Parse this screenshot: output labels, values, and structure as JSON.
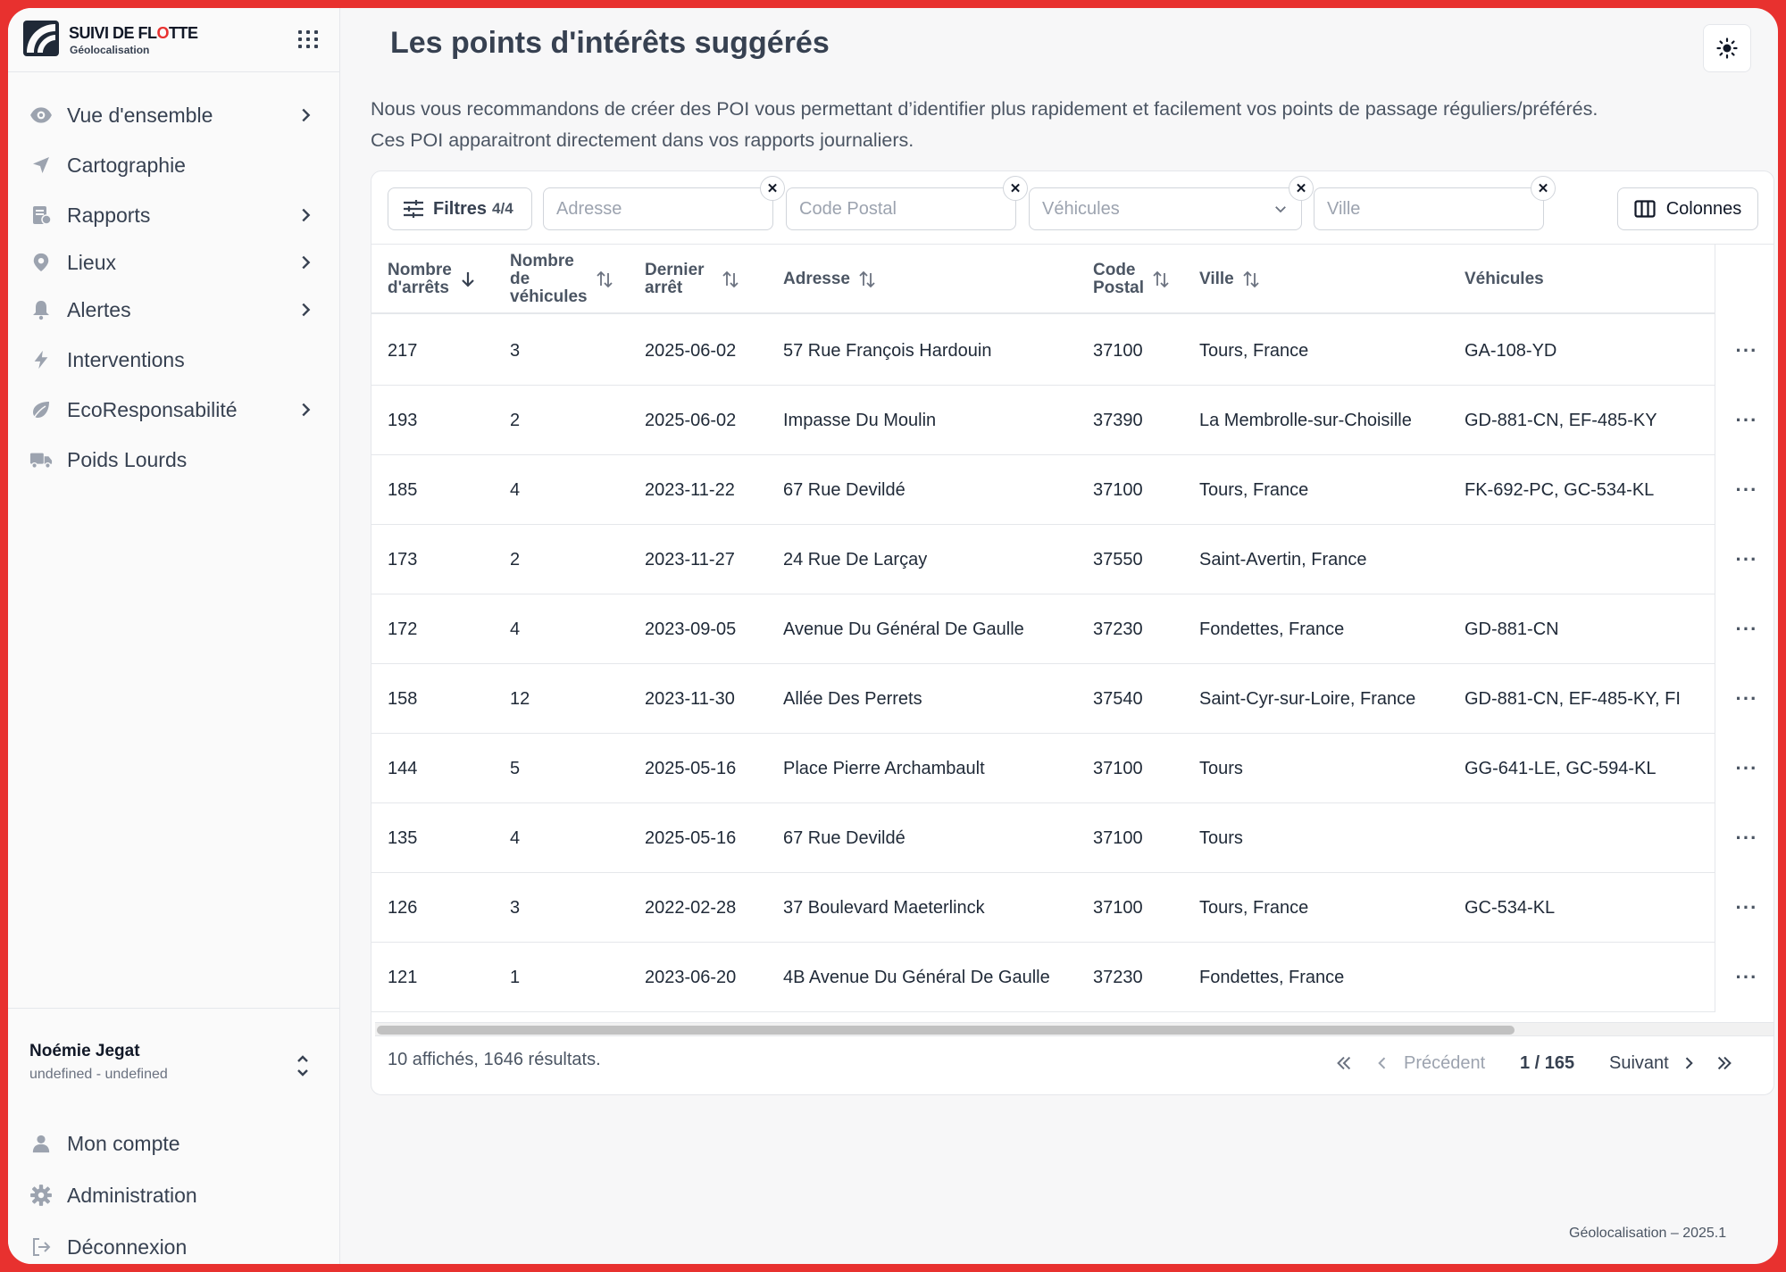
{
  "brand": {
    "name_part1": "SUIVI DE FL",
    "name_o": "O",
    "name_part2": "TTE",
    "subtitle": "Géolocalisation"
  },
  "sidebar": {
    "items": [
      {
        "label": "Vue d'ensemble",
        "icon": "eye-icon",
        "chevron": true
      },
      {
        "label": "Cartographie",
        "icon": "navigation-icon",
        "chevron": false
      },
      {
        "label": "Rapports",
        "icon": "report-icon",
        "chevron": true
      },
      {
        "label": "Lieux",
        "icon": "map-pin-icon",
        "chevron": true
      },
      {
        "label": "Alertes",
        "icon": "bell-icon",
        "chevron": true
      },
      {
        "label": "Interventions",
        "icon": "bolt-icon",
        "chevron": false
      },
      {
        "label": "EcoResponsabilité",
        "icon": "leaf-icon",
        "chevron": true
      },
      {
        "label": "Poids Lourds",
        "icon": "truck-icon",
        "chevron": false
      }
    ],
    "user": {
      "name": "Noémie Jegat",
      "org": "undefined - undefined"
    },
    "bottom": [
      {
        "label": "Mon compte",
        "icon": "user-icon"
      },
      {
        "label": "Administration",
        "icon": "gear-icon"
      },
      {
        "label": "Déconnexion",
        "icon": "logout-icon"
      }
    ]
  },
  "page": {
    "title": "Les points d'intérêts suggérés",
    "intro_line1": "Nous vous recommandons de créer des POI vous permettant d’identifier plus rapidement et facilement vos points de passage réguliers/préférés.",
    "intro_line2": "Ces POI apparaitront directement dans vos rapports journaliers."
  },
  "toolbar": {
    "filters_label": "Filtres",
    "filters_count": "4/4",
    "address_placeholder": "Adresse",
    "postal_placeholder": "Code Postal",
    "vehicles_placeholder": "Véhicules",
    "city_placeholder": "Ville",
    "columns_label": "Colonnes"
  },
  "table": {
    "headers": {
      "stops": [
        "Nombre",
        "d'arrêts"
      ],
      "vehicles_count": [
        "Nombre",
        "de",
        "véhicules"
      ],
      "last_stop": [
        "Dernier",
        "arrêt"
      ],
      "address": "Adresse",
      "postal": [
        "Code",
        "Postal"
      ],
      "city": "Ville",
      "vehicles": "Véhicules"
    },
    "rows": [
      {
        "stops": "217",
        "veh": "3",
        "date": "2025-06-02",
        "address": "57 Rue François Hardouin",
        "postal": "37100",
        "city": "Tours, France",
        "plates": "GA-108-YD"
      },
      {
        "stops": "193",
        "veh": "2",
        "date": "2025-06-02",
        "address": "Impasse Du Moulin",
        "postal": "37390",
        "city": "La Membrolle-sur-Choisille",
        "plates": "GD-881-CN, EF-485-KY"
      },
      {
        "stops": "185",
        "veh": "4",
        "date": "2023-11-22",
        "address": "67 Rue Devildé",
        "postal": "37100",
        "city": "Tours, France",
        "plates": "FK-692-PC, GC-534-KL"
      },
      {
        "stops": "173",
        "veh": "2",
        "date": "2023-11-27",
        "address": "24 Rue De Larçay",
        "postal": "37550",
        "city": "Saint-Avertin, France",
        "plates": ""
      },
      {
        "stops": "172",
        "veh": "4",
        "date": "2023-09-05",
        "address": "Avenue Du Général De Gaulle",
        "postal": "37230",
        "city": "Fondettes, France",
        "plates": "GD-881-CN"
      },
      {
        "stops": "158",
        "veh": "12",
        "date": "2023-11-30",
        "address": "Allée Des Perrets",
        "postal": "37540",
        "city": "Saint-Cyr-sur-Loire, France",
        "plates": "GD-881-CN, EF-485-KY, FI"
      },
      {
        "stops": "144",
        "veh": "5",
        "date": "2025-05-16",
        "address": "Place Pierre Archambault",
        "postal": "37100",
        "city": "Tours",
        "plates": "GG-641-LE, GC-594-KL"
      },
      {
        "stops": "135",
        "veh": "4",
        "date": "2025-05-16",
        "address": "67 Rue Devildé",
        "postal": "37100",
        "city": "Tours",
        "plates": ""
      },
      {
        "stops": "126",
        "veh": "3",
        "date": "2022-02-28",
        "address": "37 Boulevard Maeterlinck",
        "postal": "37100",
        "city": "Tours, France",
        "plates": "GC-534-KL"
      },
      {
        "stops": "121",
        "veh": "1",
        "date": "2023-06-20",
        "address": "4B Avenue Du Général De Gaulle",
        "postal": "37230",
        "city": "Fondettes, France",
        "plates": ""
      }
    ],
    "row_menu": "···"
  },
  "footer": {
    "count": "10 affichés, 1646 résultats.",
    "prev": "Précédent",
    "page": "1 / 165",
    "next": "Suivant"
  },
  "version": "Géolocalisation – 2025.1",
  "colors": {
    "frame": "#e8312f",
    "accent": "#e8312f",
    "text": "#1f2937",
    "muted": "#6b7280"
  }
}
